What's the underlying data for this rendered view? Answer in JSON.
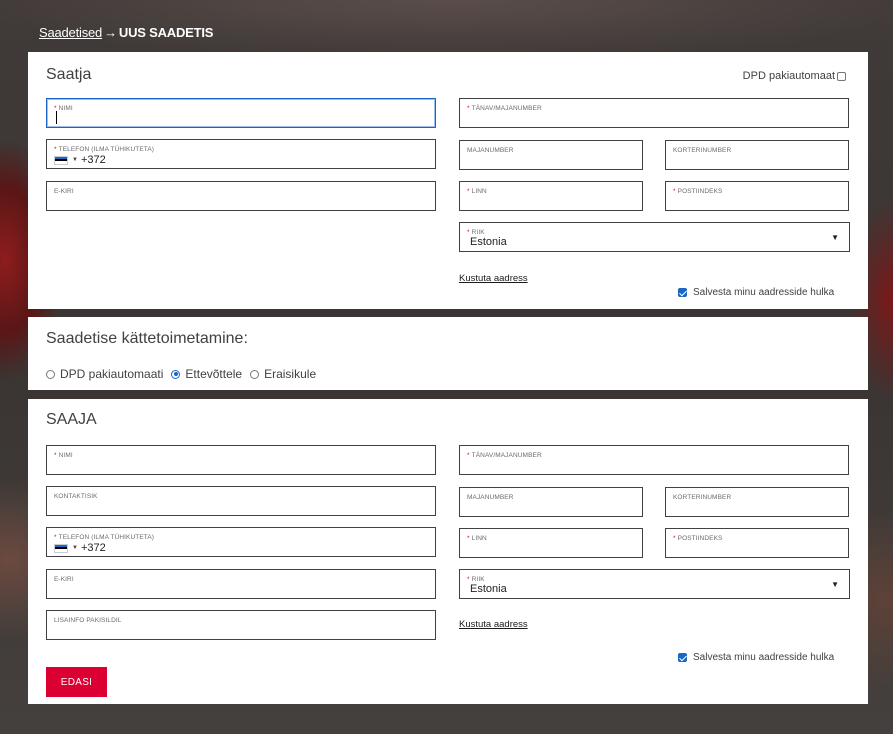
{
  "breadcrumb": {
    "parent": "Saadetised",
    "separator": "→",
    "current": "UUS SAADETIS"
  },
  "sender": {
    "title": "Saatja",
    "pakiautomaat_label": "DPD pakiautomaat",
    "pakiautomaat_checked": false,
    "fields": {
      "name": {
        "label": "NIMI",
        "required": true,
        "value": ""
      },
      "phone": {
        "label": "TELEFON (ILMA TÜHIKUTETA)",
        "required": true,
        "prefix": "+372"
      },
      "email": {
        "label": "E-KIRI",
        "required": false
      },
      "street": {
        "label": "TÄNAV/MAJANUMBER",
        "required": true
      },
      "house": {
        "label": "MAJANUMBER",
        "required": false
      },
      "apartment": {
        "label": "KORTERINUMBER",
        "required": false
      },
      "city": {
        "label": "LINN",
        "required": true
      },
      "postal": {
        "label": "POSTIINDEKS",
        "required": true
      },
      "country": {
        "label": "RIIK",
        "required": true,
        "value": "Estonia"
      }
    },
    "delete_address": "Kustuta aadress",
    "save_label": "Salvesta minu aadresside hulka",
    "save_checked": true
  },
  "delivery": {
    "title": "Saadetise kättetoimetamine:",
    "options": [
      "DPD pakiautomaati",
      "Ettevõttele",
      "Eraisikule"
    ],
    "selected": "Ettevõttele"
  },
  "receiver": {
    "title": "SAAJA",
    "fields": {
      "name": {
        "label": "NIMI",
        "required": true
      },
      "contact": {
        "label": "KONTAKTISIK",
        "required": false
      },
      "phone": {
        "label": "TELEFON (ILMA TÜHIKUTETA)",
        "required": true,
        "prefix": "+372"
      },
      "email": {
        "label": "E-KIRI",
        "required": false
      },
      "extra": {
        "label": "LISAINFO PAKISILDIL",
        "required": false
      },
      "street": {
        "label": "TÄNAV/MAJANUMBER",
        "required": true
      },
      "house": {
        "label": "MAJANUMBER",
        "required": false
      },
      "apartment": {
        "label": "KORTERINUMBER",
        "required": false
      },
      "city": {
        "label": "LINN",
        "required": true
      },
      "postal": {
        "label": "POSTIINDEKS",
        "required": true
      },
      "country": {
        "label": "RIIK",
        "required": true,
        "value": "Estonia"
      }
    },
    "delete_address": "Kustuta aadress",
    "save_label": "Salvesta minu aadresside hulka",
    "save_checked": true,
    "submit_label": "EDASI"
  },
  "colors": {
    "accent": "#dc0032",
    "focus": "#1a66c4",
    "text": "#414042"
  }
}
